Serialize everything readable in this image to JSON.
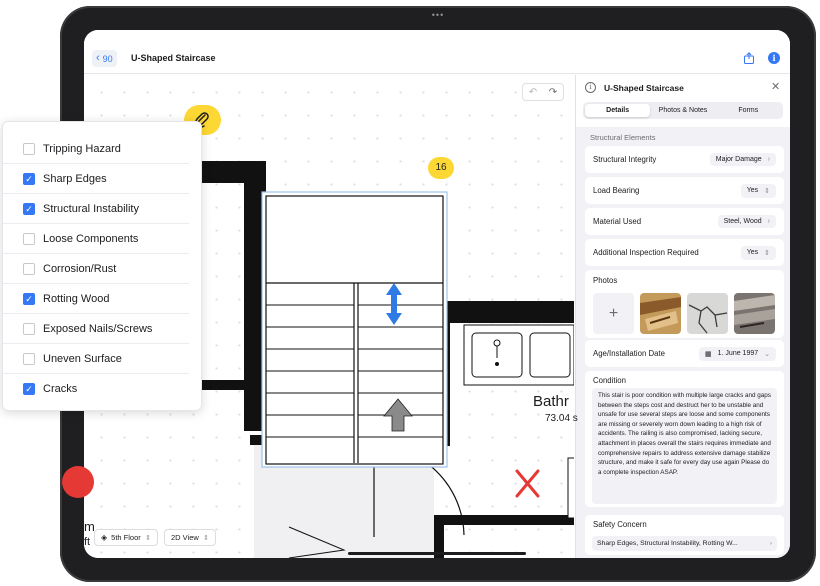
{
  "header": {
    "back_label": "90",
    "title": "U-Shaped Staircase"
  },
  "canvas": {
    "stair_number": "16",
    "room_name": "Bathr",
    "room_area": "73.04 s",
    "peek_text_1": "m",
    "peek_text_2": "ft",
    "floor_select": "5th Floor",
    "view_select": "2D View"
  },
  "checklist": {
    "items": [
      {
        "label": "Tripping Hazard",
        "checked": false
      },
      {
        "label": "Sharp Edges",
        "checked": true
      },
      {
        "label": "Structural Instability",
        "checked": true
      },
      {
        "label": "Loose Components",
        "checked": false
      },
      {
        "label": "Corrosion/Rust",
        "checked": false
      },
      {
        "label": "Rotting Wood",
        "checked": true
      },
      {
        "label": "Exposed Nails/Screws",
        "checked": false
      },
      {
        "label": "Uneven Surface",
        "checked": false
      },
      {
        "label": "Cracks",
        "checked": true
      }
    ]
  },
  "panel": {
    "title": "U-Shaped Staircase",
    "tabs": [
      "Details",
      "Photos & Notes",
      "Forms"
    ],
    "active_tab": "Details",
    "section_title": "Structural Elements",
    "fields": [
      {
        "label": "Structural Integrity",
        "value": "Major Damage"
      },
      {
        "label": "Load Bearing",
        "value": "Yes"
      },
      {
        "label": "Material Used",
        "value": "Steel, Wood"
      },
      {
        "label": "Additional Inspection Required",
        "value": "Yes"
      }
    ],
    "photos_label": "Photos",
    "age_label": "Age/Installation Date",
    "age_value": "1. June 1997",
    "condition_label": "Condition",
    "condition_text": "This stair is poor condition with multiple large cracks and gaps between the steps cost and destruct her to be unstable and unsafe for use several steps are loose and some components are missing or severely worn down leading to a high risk of accidents. The railing is also compromised, lacking secure, attachment in places overall the stairs requires immediate and comprehensive repairs to address extensive damage stabilize structure, and make it safe for every day use again Please do a complete inspection ASAP.",
    "safety_label": "Safety Concern",
    "safety_value": "Sharp Edges, Structural Instability, Rotting W..."
  },
  "colors": {
    "accent": "#3478f6",
    "highlight": "#fdd835",
    "danger": "#e53935"
  }
}
